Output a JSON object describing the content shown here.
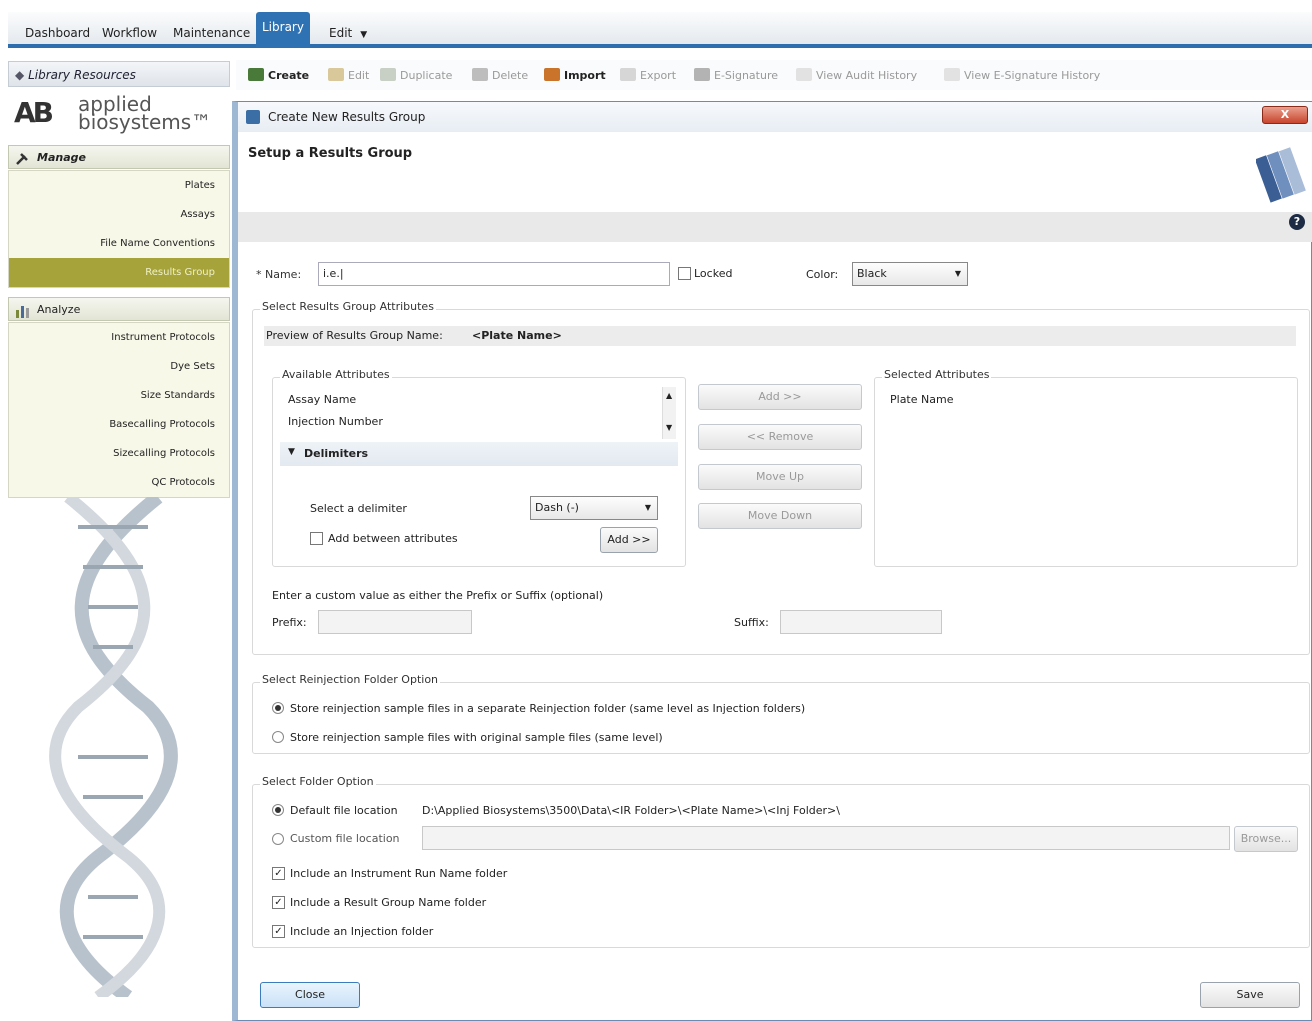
{
  "nav": {
    "tabs": [
      "Dashboard",
      "Workflow",
      "Maintenance",
      "Library",
      "Edit"
    ],
    "active": "Library"
  },
  "left": {
    "header": "Library Resources",
    "logo": {
      "mark": "AB",
      "line1": "applied",
      "line2": "biosystems™"
    },
    "manage": {
      "title": "Manage",
      "items": [
        "Plates",
        "Assays",
        "File Name Conventions",
        "Results Group"
      ]
    },
    "analyze": {
      "title": "Analyze",
      "items": [
        "Instrument Protocols",
        "Dye Sets",
        "Size Standards",
        "Basecalling Protocols",
        "Sizecalling Protocols",
        "QC Protocols"
      ]
    }
  },
  "toolbar": {
    "create": "Create",
    "edit": "Edit",
    "duplicate": "Duplicate",
    "delete": "Delete",
    "import": "Import",
    "export": "Export",
    "esig": "E-Signature",
    "audit": "View Audit History",
    "esig_history": "View E-Signature History"
  },
  "dialog": {
    "title": "Create New Results Group",
    "setup_title": "Setup a Results Group",
    "close_x": "X",
    "name_label": "* Name:",
    "name_value": "i.e.|",
    "locked_label": "Locked",
    "color_label": "Color:",
    "color_value": "Black",
    "attributes_group": "Select Results Group Attributes",
    "preview_label": "Preview of Results Group Name:",
    "preview_value": "<Plate Name>",
    "available_label": "Available Attributes",
    "available_items": [
      "Assay Name",
      "Injection Number"
    ],
    "delimiters_label": "Delimiters",
    "select_delimiter_label": "Select a delimiter",
    "delimiter_value": "Dash (-)",
    "add_between_label": "Add between attributes",
    "add_delim_button": "Add >>",
    "add_button": "Add >>",
    "remove_button": "<< Remove",
    "move_up_button": "Move Up",
    "move_down_button": "Move Down",
    "selected_label": "Selected Attributes",
    "selected_items": [
      "Plate Name"
    ],
    "custom_text": "Enter a custom value as either the Prefix or Suffix (optional)",
    "prefix_label": "Prefix:",
    "suffix_label": "Suffix:",
    "reinjection_group": "Select Reinjection Folder Option",
    "reinj_opt1": "Store reinjection sample files in a separate Reinjection folder (same level as Injection folders)",
    "reinj_opt2": "Store reinjection sample files with original sample files (same level)",
    "folder_group": "Select Folder Option",
    "default_loc_label": "Default file location",
    "default_loc_path": "D:\\Applied Biosystems\\3500\\Data\\<IR Folder>\\<Plate Name>\\<Inj Folder>\\",
    "custom_loc_label": "Custom file location",
    "browse_button": "Browse...",
    "inc_run_name": "Include an Instrument Run Name folder",
    "inc_result_group": "Include a Result Group Name folder",
    "inc_injection": "Include an Injection folder",
    "close_button": "Close",
    "save_button": "Save"
  }
}
